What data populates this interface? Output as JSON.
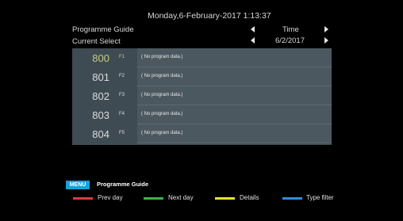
{
  "header": {
    "datetime": "Monday,6-February-2017 1:13:37",
    "guide_label": "Programme Guide",
    "current_select_label": "Current Select",
    "time_label": "Time",
    "date_value": "6/2/2017"
  },
  "channels": [
    {
      "number": "800",
      "fkey": "F1",
      "program": "( No program data.)",
      "current": true
    },
    {
      "number": "801",
      "fkey": "F2",
      "program": "( No program data.)"
    },
    {
      "number": "802",
      "fkey": "F3",
      "program": "( No program data.)"
    },
    {
      "number": "803",
      "fkey": "F4",
      "program": "( No program data.)"
    },
    {
      "number": "804",
      "fkey": "F5",
      "program": "( No program data.)"
    }
  ],
  "footer": {
    "menu_badge": "MENU",
    "menu_title": "Programme Guide",
    "legend": [
      {
        "label": "Prev day",
        "color": "#e03a3a",
        "icon": "red-key"
      },
      {
        "label": "Next day",
        "color": "#3db24a",
        "icon": "green-key"
      },
      {
        "label": "Details",
        "color": "#f0e030",
        "icon": "yellow-key"
      },
      {
        "label": "Type filter",
        "color": "#2a8fe0",
        "icon": "blue-key"
      }
    ]
  }
}
